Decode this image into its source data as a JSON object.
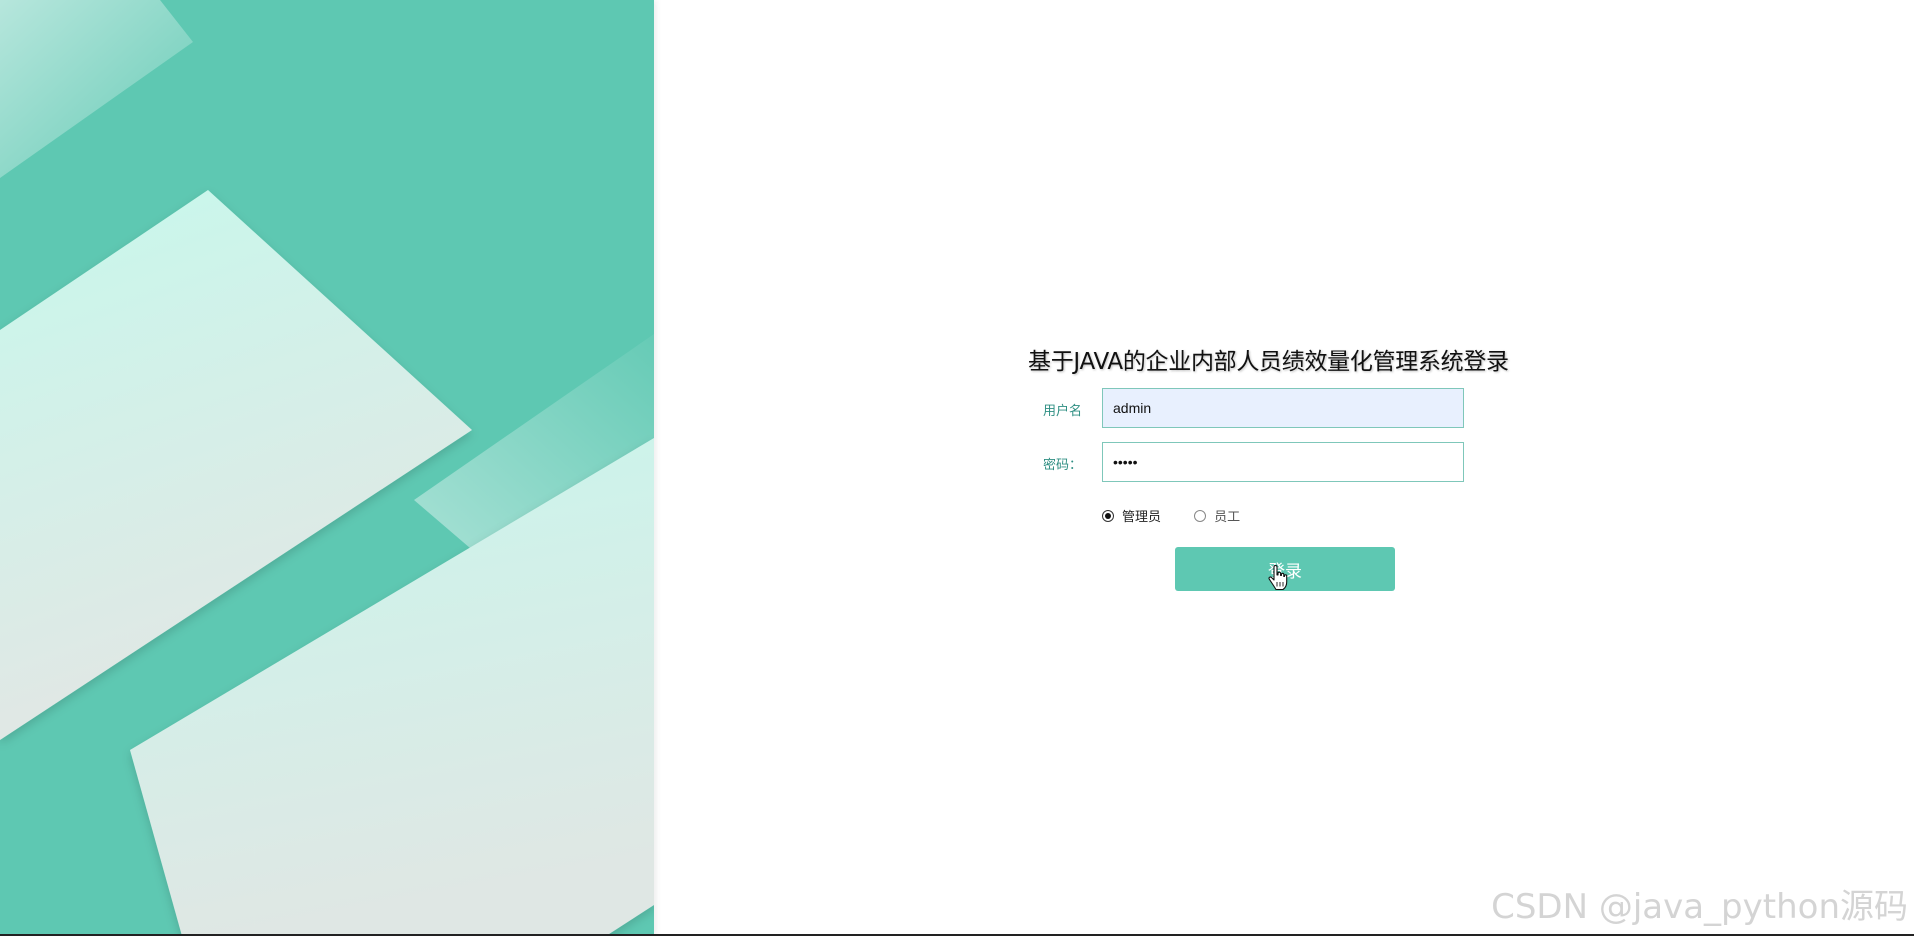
{
  "login": {
    "title": "基于JAVA的企业内部人员绩效量化管理系统登录",
    "username_label": "用户名",
    "username_value": "admin",
    "password_label": "密码：",
    "password_value": "•••••",
    "roles": [
      {
        "label": "管理员",
        "checked": true
      },
      {
        "label": "员工",
        "checked": false
      }
    ],
    "submit_label": "登录"
  },
  "watermark": "CSDN @java_python源码",
  "colors": {
    "accent": "#5ec8b2",
    "panel_light": "#c8f5ea",
    "input_fill": "#e8f0fe",
    "label": "#2f8f83"
  },
  "icons": {
    "cursor": "hand-pointer-icon",
    "radio_checked": "radio-checked-icon",
    "radio_unchecked": "radio-unchecked-icon"
  }
}
